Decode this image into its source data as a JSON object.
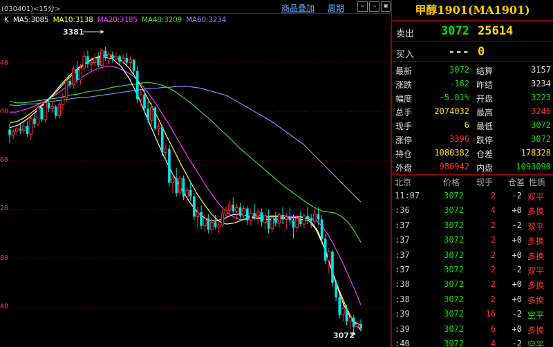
{
  "header": {
    "title": "(030401)<15分>",
    "links": [
      "商品叠加",
      "周期"
    ],
    "buttons": [
      "⇦",
      "⇨",
      "▣",
      "⊟"
    ]
  },
  "legend": {
    "k": "K",
    "items": [
      {
        "text": "MA5:3085",
        "color": "#ffffff"
      },
      {
        "text": "MA10:3138",
        "color": "#ffff33"
      },
      {
        "text": "MA20:3185",
        "color": "#ff33ff"
      },
      {
        "text": "MA40:3209",
        "color": "#33dd33"
      },
      {
        "text": "MA60:3234",
        "color": "#8888ff"
      }
    ]
  },
  "chart_data": {
    "type": "candlestick",
    "period": "15分",
    "labels": {
      "high": "3381",
      "low": "3072"
    },
    "y_axis_tick_suffix": [
      "40",
      "00",
      "60",
      "20",
      "80",
      "40"
    ],
    "candles": [
      [
        3291,
        3297,
        3276,
        3285
      ],
      [
        3285,
        3292,
        3280,
        3289
      ],
      [
        3289,
        3296,
        3284,
        3292
      ],
      [
        3292,
        3297,
        3286,
        3290
      ],
      [
        3290,
        3299,
        3287,
        3295
      ],
      [
        3295,
        3300,
        3283,
        3286
      ],
      [
        3286,
        3306,
        3280,
        3303
      ],
      [
        3303,
        3309,
        3293,
        3297
      ],
      [
        3297,
        3318,
        3294,
        3315
      ],
      [
        3315,
        3318,
        3299,
        3302
      ],
      [
        3302,
        3323,
        3298,
        3320
      ],
      [
        3320,
        3326,
        3310,
        3314
      ],
      [
        3314,
        3321,
        3309,
        3316
      ],
      [
        3316,
        3318,
        3303,
        3306
      ],
      [
        3306,
        3322,
        3303,
        3318
      ],
      [
        3318,
        3330,
        3312,
        3326
      ],
      [
        3326,
        3347,
        3321,
        3344
      ],
      [
        3344,
        3349,
        3336,
        3340
      ],
      [
        3340,
        3360,
        3335,
        3357
      ],
      [
        3357,
        3366,
        3341,
        3345
      ],
      [
        3345,
        3362,
        3340,
        3358
      ],
      [
        3358,
        3376,
        3354,
        3371
      ],
      [
        3371,
        3377,
        3358,
        3362
      ],
      [
        3362,
        3369,
        3355,
        3364
      ],
      [
        3364,
        3374,
        3360,
        3369
      ],
      [
        3369,
        3375,
        3359,
        3361
      ],
      [
        3361,
        3379,
        3357,
        3377
      ],
      [
        3377,
        3381,
        3366,
        3369
      ],
      [
        3369,
        3376,
        3362,
        3373
      ],
      [
        3373,
        3376,
        3364,
        3368
      ],
      [
        3368,
        3375,
        3362,
        3371
      ],
      [
        3371,
        3373,
        3361,
        3365
      ],
      [
        3365,
        3373,
        3362,
        3369
      ],
      [
        3369,
        3374,
        3360,
        3364
      ],
      [
        3364,
        3371,
        3358,
        3367
      ],
      [
        3367,
        3368,
        3350,
        3355
      ],
      [
        3355,
        3360,
        3320,
        3324
      ],
      [
        3324,
        3334,
        3316,
        3329
      ],
      [
        3329,
        3334,
        3310,
        3314
      ],
      [
        3314,
        3322,
        3298,
        3301
      ],
      [
        3301,
        3320,
        3296,
        3315
      ],
      [
        3315,
        3317,
        3289,
        3292
      ],
      [
        3292,
        3299,
        3285,
        3294
      ],
      [
        3294,
        3296,
        3262,
        3266
      ],
      [
        3266,
        3275,
        3258,
        3270
      ],
      [
        3270,
        3274,
        3229,
        3233
      ],
      [
        3233,
        3243,
        3222,
        3238
      ],
      [
        3238,
        3249,
        3218,
        3222
      ],
      [
        3222,
        3241,
        3219,
        3238
      ],
      [
        3238,
        3241,
        3214,
        3218
      ],
      [
        3218,
        3229,
        3208,
        3225
      ],
      [
        3225,
        3235,
        3213,
        3218
      ],
      [
        3218,
        3222,
        3192,
        3196
      ],
      [
        3196,
        3206,
        3183,
        3201
      ],
      [
        3201,
        3208,
        3182,
        3186
      ],
      [
        3186,
        3198,
        3180,
        3194
      ],
      [
        3194,
        3199,
        3178,
        3182
      ],
      [
        3182,
        3195,
        3177,
        3190
      ],
      [
        3190,
        3198,
        3182,
        3185
      ],
      [
        3185,
        3192,
        3177,
        3187
      ],
      [
        3187,
        3204,
        3184,
        3199
      ],
      [
        3199,
        3207,
        3192,
        3203
      ],
      [
        3203,
        3214,
        3195,
        3209
      ],
      [
        3209,
        3217,
        3199,
        3202
      ],
      [
        3202,
        3210,
        3193,
        3206
      ],
      [
        3206,
        3211,
        3194,
        3197
      ],
      [
        3197,
        3208,
        3192,
        3205
      ],
      [
        3205,
        3208,
        3187,
        3192
      ],
      [
        3192,
        3204,
        3186,
        3200
      ],
      [
        3200,
        3210,
        3192,
        3196
      ],
      [
        3196,
        3205,
        3188,
        3201
      ],
      [
        3201,
        3205,
        3185,
        3190
      ],
      [
        3190,
        3200,
        3182,
        3197
      ],
      [
        3197,
        3204,
        3178,
        3183
      ],
      [
        3183,
        3198,
        3180,
        3195
      ],
      [
        3195,
        3201,
        3185,
        3189
      ],
      [
        3189,
        3201,
        3184,
        3198
      ],
      [
        3198,
        3206,
        3188,
        3193
      ],
      [
        3193,
        3200,
        3182,
        3196
      ],
      [
        3196,
        3206,
        3187,
        3192
      ],
      [
        3192,
        3198,
        3172,
        3184
      ],
      [
        3184,
        3198,
        3179,
        3194
      ],
      [
        3194,
        3202,
        3185,
        3188
      ],
      [
        3188,
        3200,
        3183,
        3197
      ],
      [
        3197,
        3207,
        3188,
        3194
      ],
      [
        3194,
        3199,
        3184,
        3191
      ],
      [
        3191,
        3205,
        3187,
        3199
      ],
      [
        3199,
        3206,
        3187,
        3193
      ],
      [
        3193,
        3198,
        3168,
        3172
      ],
      [
        3172,
        3177,
        3144,
        3148
      ],
      [
        3148,
        3162,
        3134,
        3158
      ],
      [
        3158,
        3160,
        3120,
        3124
      ],
      [
        3124,
        3127,
        3104,
        3108
      ],
      [
        3108,
        3112,
        3085,
        3089
      ],
      [
        3089,
        3100,
        3082,
        3096
      ],
      [
        3096,
        3100,
        3078,
        3082
      ],
      [
        3082,
        3090,
        3074,
        3086
      ],
      [
        3086,
        3089,
        3071,
        3076
      ],
      [
        3076,
        3082,
        3072,
        3079
      ],
      [
        3079,
        3084,
        3071,
        3074
      ]
    ],
    "ma_lines": [
      {
        "name": "MA60",
        "color": "#8888ff",
        "values": [
          3318,
          3317,
          3318,
          3319,
          3319,
          3320,
          3321,
          3322,
          3323,
          3324,
          3325,
          3326,
          3326,
          3327,
          3328,
          3329,
          3330,
          3331,
          3332,
          3333,
          3334,
          3335,
          3336,
          3336,
          3337,
          3337,
          3338,
          3338,
          3338,
          3337,
          3336,
          3334,
          3332,
          3330,
          3328,
          3324,
          3320,
          3316,
          3312,
          3308,
          3304,
          3300,
          3295,
          3290,
          3285,
          3280,
          3275,
          3268,
          3261,
          3254,
          3247,
          3240,
          3233,
          3226,
          3219,
          3212
        ]
      },
      {
        "name": "MA40",
        "color": "#33dd33",
        "values": [
          3322,
          3320,
          3320,
          3321,
          3322,
          3323,
          3324,
          3325,
          3326,
          3328,
          3329,
          3330,
          3332,
          3333,
          3334,
          3335,
          3337,
          3338,
          3339,
          3340,
          3341,
          3342,
          3342,
          3341,
          3339,
          3336,
          3332,
          3327,
          3322,
          3316,
          3310,
          3304,
          3298,
          3291,
          3285,
          3278,
          3271,
          3265,
          3259,
          3253,
          3247,
          3241,
          3235,
          3229,
          3224,
          3219,
          3214,
          3209,
          3205,
          3202,
          3201,
          3200,
          3196,
          3190,
          3180,
          3168
        ]
      },
      {
        "name": "MA20",
        "color": "#ff33ff",
        "values": [
          3310,
          3310,
          3312,
          3314,
          3317,
          3320,
          3324,
          3328,
          3333,
          3338,
          3342,
          3347,
          3351,
          3355,
          3358,
          3360,
          3360,
          3358,
          3355,
          3351,
          3345,
          3337,
          3328,
          3318,
          3307,
          3296,
          3284,
          3272,
          3260,
          3249,
          3238,
          3227,
          3217,
          3208,
          3201,
          3196,
          3193,
          3193,
          3194,
          3195,
          3196,
          3197,
          3197,
          3197,
          3196,
          3196,
          3195,
          3195,
          3192,
          3185,
          3175,
          3162,
          3148,
          3133,
          3117,
          3100
        ]
      },
      {
        "name": "MA10",
        "color": "#ffff33",
        "values": [
          3298,
          3300,
          3304,
          3310,
          3316,
          3322,
          3330,
          3339,
          3348,
          3355,
          3362,
          3368,
          3371,
          3372,
          3370,
          3366,
          3358,
          3346,
          3332,
          3317,
          3301,
          3284,
          3268,
          3252,
          3237,
          3222,
          3210,
          3199,
          3191,
          3188,
          3189,
          3192,
          3195,
          3197,
          3197,
          3196,
          3196,
          3195,
          3195,
          3193,
          3192,
          3182,
          3164,
          3140,
          3118,
          3098,
          3082,
          3072
        ]
      },
      {
        "name": "MA5",
        "color": "#ffffff",
        "values": [
          3293,
          3296,
          3302,
          3310,
          3319,
          3329,
          3340,
          3350,
          3358,
          3364,
          3369,
          3370,
          3368,
          3360,
          3346,
          3327,
          3305,
          3283,
          3262,
          3243,
          3227,
          3212,
          3200,
          3193,
          3191,
          3194,
          3198,
          3199,
          3196,
          3194,
          3193,
          3193,
          3194,
          3195,
          3196,
          3193,
          3180,
          3156,
          3126,
          3100,
          3082,
          3078
        ]
      }
    ]
  },
  "panel": {
    "title": "甲醇1901(MA1901)",
    "sell": {
      "label": "卖出",
      "price": "3072",
      "volume": "25614"
    },
    "buy": {
      "label": "买入",
      "price": "---",
      "volume": "0"
    },
    "quote": [
      {
        "l1": "最新",
        "v1": "3072",
        "c1": "#00e000",
        "l2": "结算",
        "v2": "3157",
        "c2": "#dddddd"
      },
      {
        "l1": "涨跌",
        "v1": "-162",
        "c1": "#00e000",
        "l2": "昨结",
        "v2": "3234",
        "c2": "#dddddd"
      },
      {
        "l1": "幅度",
        "v1": "-5.01%",
        "c1": "#00e000",
        "l2": "开盘",
        "v2": "3223",
        "c2": "#00e000"
      },
      {
        "l1": "总手",
        "v1": "2074032",
        "c1": "#ffdd00",
        "l2": "最高",
        "v2": "3246",
        "c2": "#ff3030"
      },
      {
        "l1": "现手",
        "v1": "6",
        "c1": "#ffdd00",
        "l2": "最低",
        "v2": "3072",
        "c2": "#00e000"
      },
      {
        "l1": "涨停",
        "v1": "3396",
        "c1": "#ff3030",
        "l2": "跌停",
        "v2": "3072",
        "c2": "#00e000"
      },
      {
        "l1": "持仓",
        "v1": "1080382",
        "c1": "#ffdd00",
        "l2": "仓差",
        "v2": "178328",
        "c2": "#ffdd00"
      },
      {
        "l1": "外盘",
        "v1": "980942",
        "c1": "#ff3030",
        "l2": "内盘",
        "v2": "1093090",
        "c2": "#00e000"
      }
    ],
    "ticks_header": [
      "北京",
      "价格",
      "现手",
      "仓差",
      "性质"
    ],
    "ticks": [
      {
        "time": "11:07",
        "price": "3072",
        "vol": "2",
        "chg": "-2",
        "type": "双平",
        "tc": "#ff3030"
      },
      {
        "time": ":36",
        "price": "3072",
        "vol": "4",
        "chg": "+0",
        "type": "多换",
        "tc": "#ff3030"
      },
      {
        "time": ":37",
        "price": "3072",
        "vol": "2",
        "chg": "-2",
        "type": "双平",
        "tc": "#ff3030"
      },
      {
        "time": ":37",
        "price": "3072",
        "vol": "2",
        "chg": "+0",
        "type": "多换",
        "tc": "#ff3030"
      },
      {
        "time": ":37",
        "price": "3072",
        "vol": "2",
        "chg": "+0",
        "type": "多换",
        "tc": "#ff3030"
      },
      {
        "time": ":37",
        "price": "3072",
        "vol": "2",
        "chg": "-2",
        "type": "双平",
        "tc": "#ff3030"
      },
      {
        "time": ":38",
        "price": "3072",
        "vol": "2",
        "chg": "+0",
        "type": "多换",
        "tc": "#ff3030"
      },
      {
        "time": ":38",
        "price": "3072",
        "vol": "2",
        "chg": "+0",
        "type": "多换",
        "tc": "#ff3030"
      },
      {
        "time": ":39",
        "price": "3072",
        "vol": "16",
        "chg": "-2",
        "type": "空平",
        "tc": "#00e000"
      },
      {
        "time": ":39",
        "price": "3072",
        "vol": "6",
        "chg": "+0",
        "type": "多换",
        "tc": "#ff3030"
      },
      {
        "time": ":40",
        "price": "3072",
        "vol": "4",
        "chg": "-2",
        "type": "空平",
        "tc": "#00e000"
      }
    ]
  }
}
